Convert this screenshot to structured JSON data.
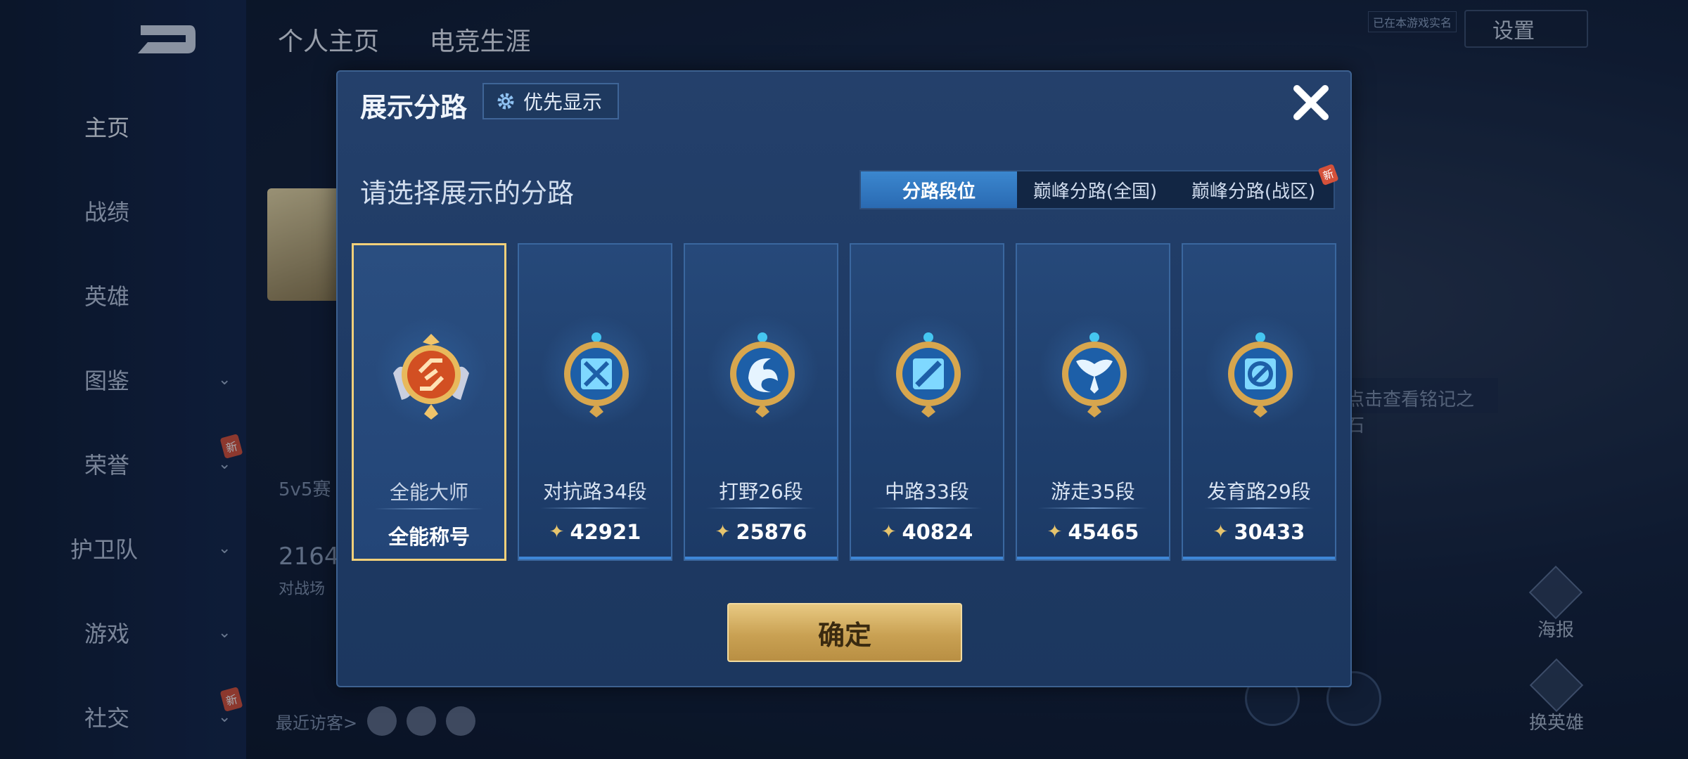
{
  "sidebar": {
    "items": [
      {
        "label": "主页",
        "has_chevron": false
      },
      {
        "label": "战绩",
        "has_chevron": false
      },
      {
        "label": "英雄",
        "has_chevron": false
      },
      {
        "label": "图鉴",
        "has_chevron": true
      },
      {
        "label": "荣誉",
        "has_chevron": true,
        "badge": "新"
      },
      {
        "label": "护卫队",
        "has_chevron": true
      },
      {
        "label": "游戏",
        "has_chevron": true
      },
      {
        "label": "社交",
        "has_chevron": true,
        "badge": "新"
      }
    ],
    "back_icon": "back-arrow-icon"
  },
  "background_page": {
    "tabs": [
      "个人主页",
      "电竞生涯"
    ],
    "settings_label": "设置",
    "game_name_badge": "已在本游戏实名",
    "mode_label": "5v5赛",
    "stat_value": "2164",
    "stat_sub": "对战场",
    "visitors_label": "最近访客>",
    "rune_hint": "点击查看铭记之石",
    "poster_label": "海报",
    "change_hero_label": "换英雄",
    "new_badge": "新"
  },
  "modal": {
    "title": "展示分路",
    "priority_label": "优先显示",
    "prompt": "请选择展示的分路",
    "tabs": [
      {
        "label": "分路段位",
        "active": true
      },
      {
        "label": "巅峰分路(全国)",
        "active": false
      },
      {
        "label": "巅峰分路(战区)",
        "active": false,
        "badge": "新"
      }
    ],
    "cards": [
      {
        "name": "全能大师",
        "value": "全能称号",
        "selected": true,
        "emblem": "all-round-emblem-icon",
        "has_power_icon": false
      },
      {
        "name": "对抗路34段",
        "value": "42921",
        "selected": false,
        "emblem": "clash-lane-emblem-icon",
        "has_power_icon": true
      },
      {
        "name": "打野26段",
        "value": "25876",
        "selected": false,
        "emblem": "jungle-emblem-icon",
        "has_power_icon": true
      },
      {
        "name": "中路33段",
        "value": "40824",
        "selected": false,
        "emblem": "mid-lane-emblem-icon",
        "has_power_icon": true
      },
      {
        "name": "游走35段",
        "value": "45465",
        "selected": false,
        "emblem": "roam-emblem-icon",
        "has_power_icon": true
      },
      {
        "name": "发育路29段",
        "value": "30433",
        "selected": false,
        "emblem": "farm-lane-emblem-icon",
        "has_power_icon": true
      }
    ],
    "confirm_label": "确定",
    "colors": {
      "accent_blue": "#2a6ab2",
      "gold": "#e6c46d",
      "selected_border": "#f2d07a"
    }
  }
}
